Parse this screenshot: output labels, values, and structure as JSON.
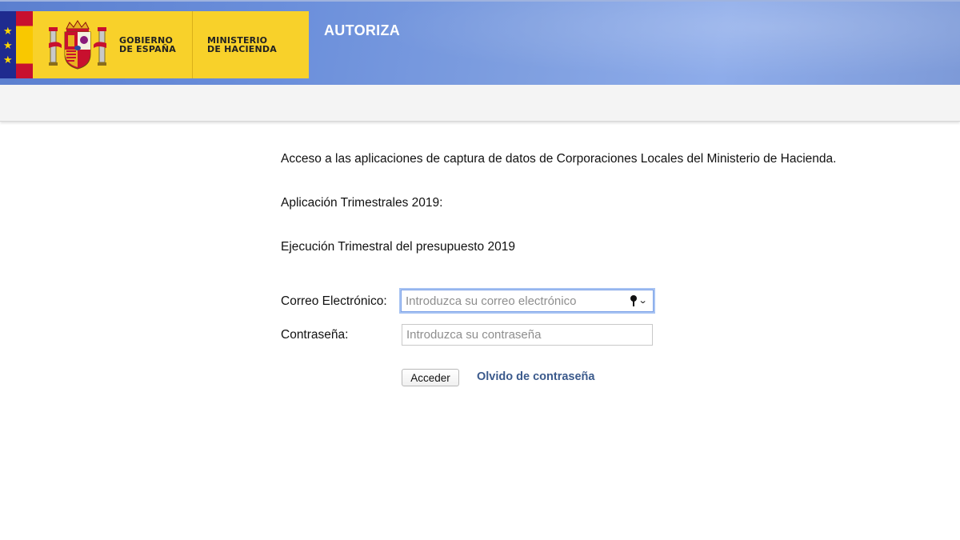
{
  "header": {
    "government_line1": "GOBIERNO",
    "government_line2": "DE ESPAÑA",
    "ministry_line1": "MINISTERIO",
    "ministry_line2": "DE HACIENDA",
    "app_title": "AUTORIZA",
    "eu_star_glyph": "★"
  },
  "content": {
    "intro_text": "Acceso a las aplicaciones de captura de datos de Corporaciones Locales del Ministerio de Hacienda.",
    "application_text": "Aplicación Trimestrales 2019:",
    "execution_text": "Ejecución Trimestral del presupuesto 2019"
  },
  "form": {
    "email_label": "Correo Electrónico:",
    "email_placeholder": "Introduzca su correo electrónico",
    "email_value": "",
    "password_label": "Contraseña:",
    "password_placeholder": "Introduzca su contraseña",
    "password_value": "",
    "submit_label": "Acceder",
    "forgot_link": "Olvido de contraseña"
  },
  "icons": {
    "autofill": "key-icon",
    "autofill_menu": "chevron-down-icon",
    "chevron_glyph": "⌄"
  },
  "colors": {
    "header_blue": "#6b8fdb",
    "gov_yellow": "#f8d12a",
    "eu_blue": "#1f2b8f",
    "link_blue": "#3b5a8c",
    "focus_ring": "#a7c3f3"
  }
}
